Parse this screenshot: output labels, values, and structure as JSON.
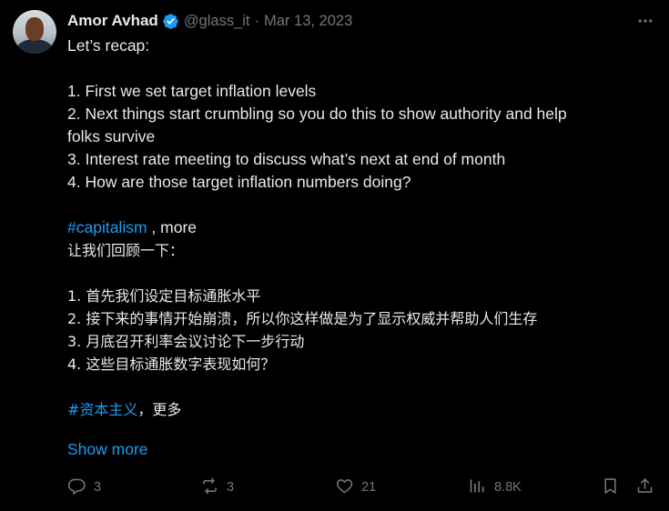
{
  "author": {
    "name": "Amor Avhad",
    "handle": "@glass_it",
    "separator": "·",
    "date": "Mar 13, 2023"
  },
  "tweet": {
    "lines_en": [
      "Let’s recap:",
      "",
      "1. First we set target inflation levels",
      "2. Next things start crumbling so you do this to show authority and help",
      "folks survive",
      "3. Interest rate meeting to discuss what’s next at end of month",
      "4. How are those target inflation numbers doing?",
      ""
    ],
    "hashtag_en": "#capitalism",
    "hashtag_en_suffix": " , more",
    "lines_zh": [
      "让我们回顾一下：",
      "",
      "1. 首先我们设定目标通胀水平",
      "2. 接下来的事情开始崩溃，所以你这样做是为了显示权威并帮助人们生存",
      "3.  月底召开利率会议讨论下一步行动",
      "4.  这些目标通胀数字表现如何？",
      ""
    ],
    "hashtag_zh": "#资本主义",
    "hashtag_zh_suffix": "，更多",
    "show_more": "Show more"
  },
  "metrics": {
    "replies": "3",
    "reposts": "3",
    "likes": "21",
    "views": "8.8K"
  },
  "icons": {
    "verified": "verified-badge-icon",
    "more": "more-horizontal-icon",
    "reply": "reply-icon",
    "repost": "repost-icon",
    "like": "heart-icon",
    "views": "analytics-icon",
    "bookmark": "bookmark-icon",
    "share": "share-icon"
  },
  "colors": {
    "background": "#000000",
    "text": "#e7e9ea",
    "muted": "#71767b",
    "accent": "#1d9bf0"
  }
}
